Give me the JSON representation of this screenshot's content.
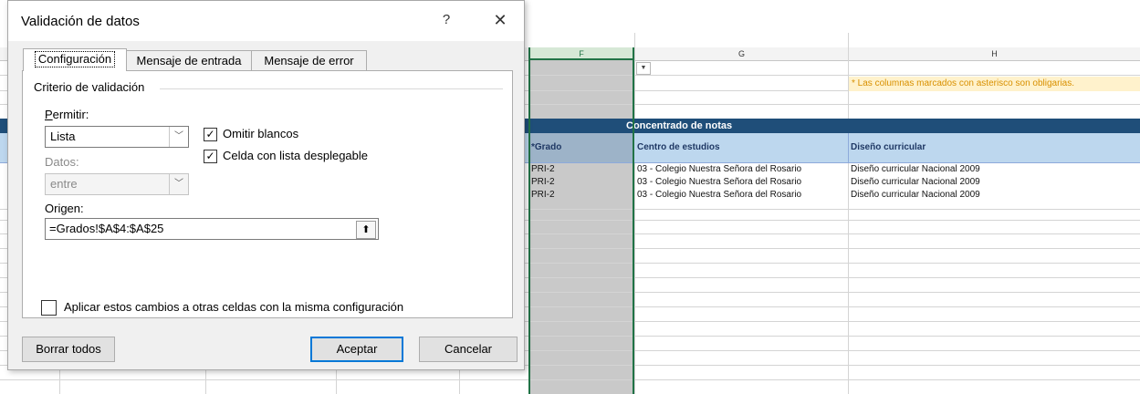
{
  "spreadsheet": {
    "columns": [
      "F",
      "G",
      "H"
    ],
    "note": "* Las columnas marcados con asterisco son obligarias.",
    "band_title": "Concentrado de notas",
    "headers": {
      "grado": "*Grado",
      "centro": "Centro de estudios",
      "diseno": "Diseño curricular"
    },
    "rows": [
      {
        "grado": "PRI-2",
        "centro": "03 - Colegio Nuestra Señora del Rosario",
        "diseno": "Diseño curricular Nacional 2009"
      },
      {
        "grado": "PRI-2",
        "centro": "03 - Colegio Nuestra Señora del Rosario",
        "diseno": "Diseño curricular Nacional 2009"
      },
      {
        "grado": "PRI-2",
        "centro": "03 - Colegio Nuestra Señora del Rosario",
        "diseno": "Diseño curricular Nacional 2009"
      }
    ]
  },
  "dialog": {
    "title": "Validación de datos",
    "help": "?",
    "close": "✕",
    "tabs": [
      "Configuración",
      "Mensaje de entrada",
      "Mensaje de error"
    ],
    "group_label": "Criterio de validación",
    "permitir_label": "Permitir:",
    "permitir_value": "Lista",
    "omitir_label": "Omitir blancos",
    "celda_label": "Celda con lista desplegable",
    "datos_label": "Datos:",
    "datos_value": "entre",
    "origen_label": "Origen:",
    "origen_value": "=Grados!$A$4:$A$25",
    "aplicar_label": "Aplicar estos cambios a otras celdas con la misma configuración",
    "buttons": {
      "borrar": "Borrar todos",
      "aceptar": "Aceptar",
      "cancelar": "Cancelar"
    },
    "checks": {
      "omitir": true,
      "celda": true,
      "aplicar": false
    }
  }
}
